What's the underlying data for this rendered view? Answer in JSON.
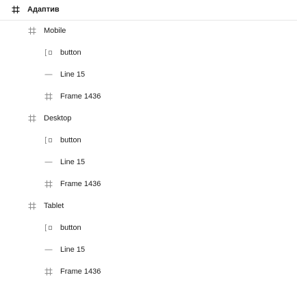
{
  "layers": {
    "root": {
      "label": "Адаптив",
      "icon": "frame-icon"
    },
    "groups": [
      {
        "label": "Mobile",
        "icon": "frame-icon",
        "children": [
          {
            "label": "button",
            "icon": "component-icon"
          },
          {
            "label": "Line 15",
            "icon": "line-icon"
          },
          {
            "label": "Frame 1436",
            "icon": "frame-icon"
          }
        ]
      },
      {
        "label": "Desktop",
        "icon": "frame-icon",
        "children": [
          {
            "label": "button",
            "icon": "component-icon"
          },
          {
            "label": "Line 15",
            "icon": "line-icon"
          },
          {
            "label": "Frame 1436",
            "icon": "frame-icon"
          }
        ]
      },
      {
        "label": "Tablet",
        "icon": "frame-icon",
        "children": [
          {
            "label": "button",
            "icon": "component-icon"
          },
          {
            "label": "Line 15",
            "icon": "line-icon"
          },
          {
            "label": "Frame 1436",
            "icon": "frame-icon"
          }
        ]
      }
    ]
  },
  "colors": {
    "root_icon": "#1a1a1a",
    "icon": "#8c8c8c",
    "text": "#1a1a1a",
    "divider": "#e6e6e6"
  }
}
